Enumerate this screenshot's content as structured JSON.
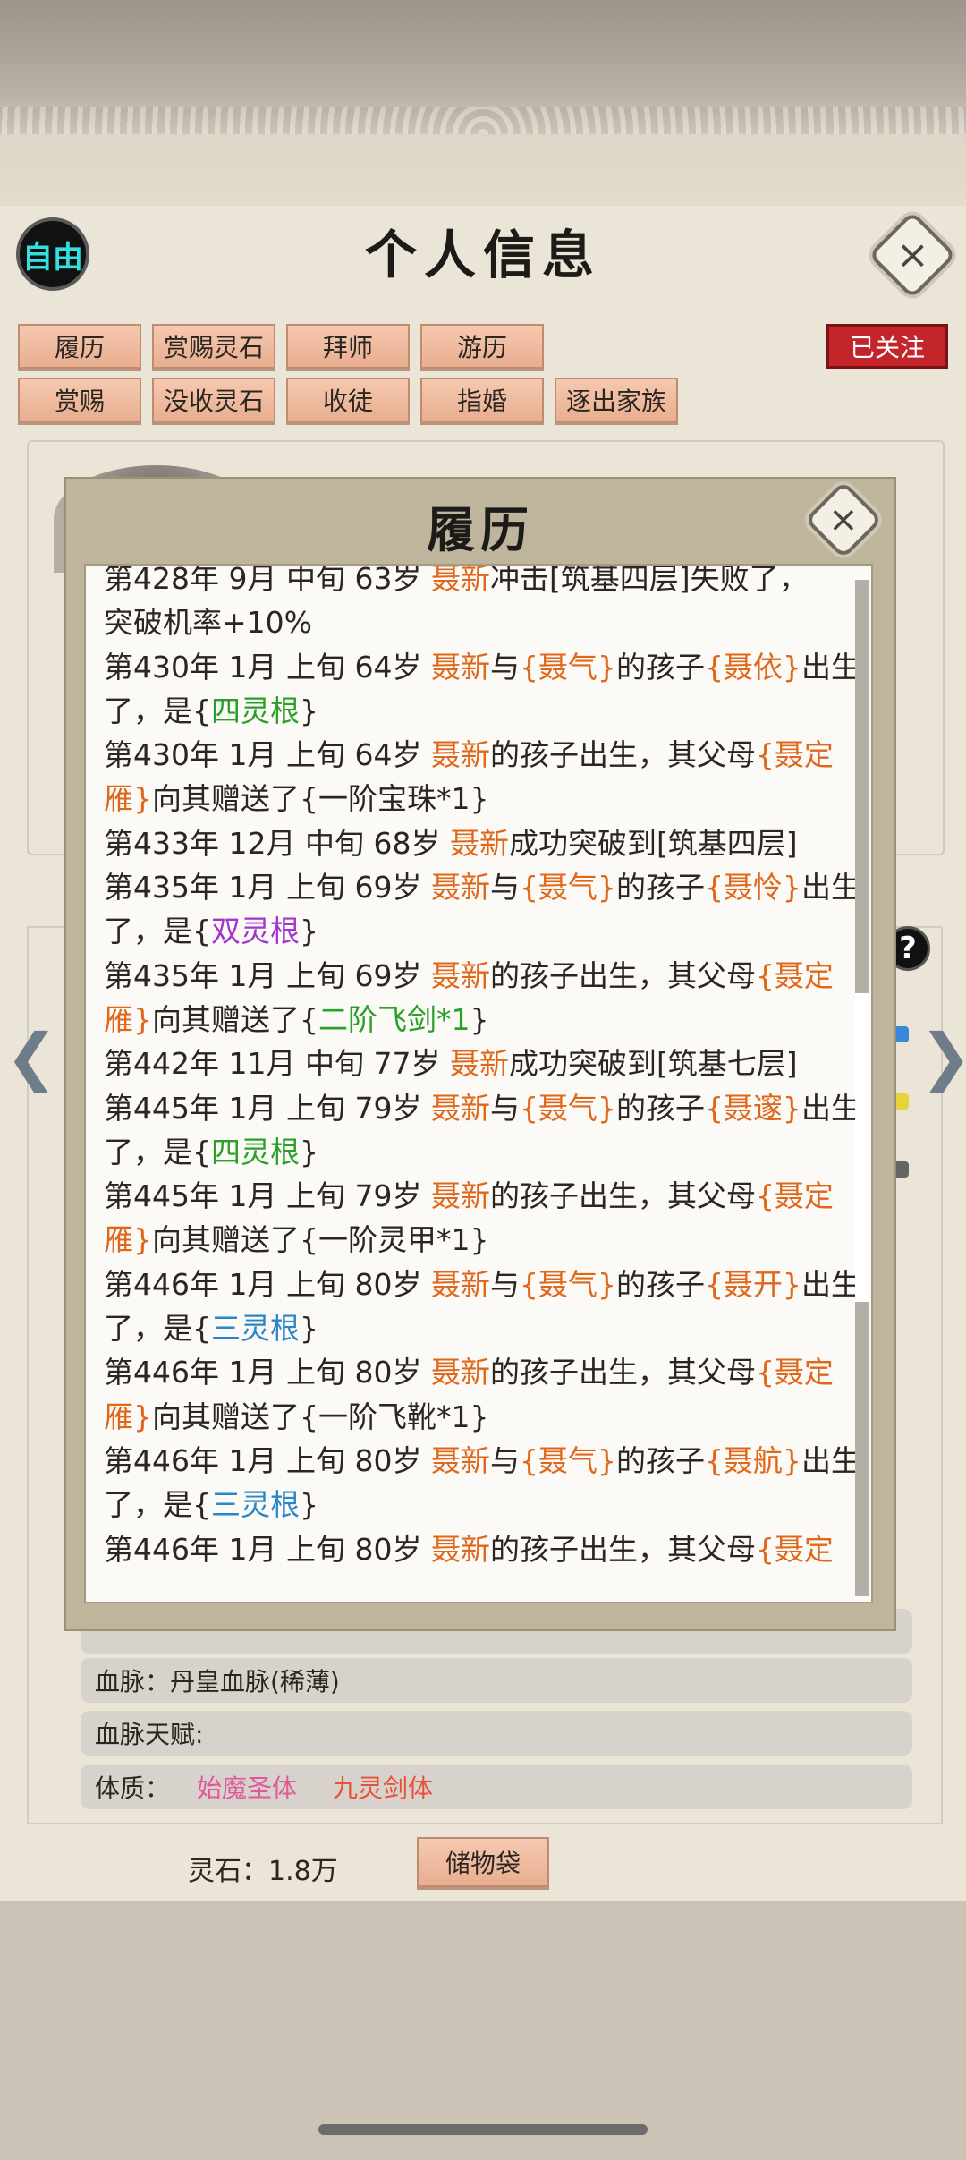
{
  "header": {
    "free_badge": "自由",
    "title": "个人信息",
    "close_icon": "×",
    "followed": "已关注"
  },
  "tabs_row1": [
    "履历",
    "赏赐灵石",
    "拜师",
    "游历"
  ],
  "tabs_row2": [
    "赏赐",
    "没收灵石",
    "收徒",
    "指婚",
    "逐出家族"
  ],
  "profile": {
    "bloodline": "血脉：丹皇血脉(稀薄)",
    "bloodline_talent": "血脉天赋:",
    "physique_label": "体质：",
    "physique_1": "始魔圣体",
    "physique_2": "九灵剑体",
    "physique_colors": [
      "#e0589a",
      "#e8503a"
    ],
    "spirit_stones": "灵石：1.8万",
    "storage_bag": "储物袋"
  },
  "modal": {
    "title": "履历",
    "close_icon": "×",
    "log_lines": [
      [
        {
          "t": "第428年 9月 中旬  63岁  "
        },
        {
          "t": "聂新",
          "c": "o"
        },
        {
          "t": "冲击[筑基四层]失败了，"
        }
      ],
      [
        {
          "t": "突破机率+10%"
        }
      ],
      [
        {
          "t": "第430年 1月 上旬 64岁 "
        },
        {
          "t": "聂新",
          "c": "o"
        },
        {
          "t": "与"
        },
        {
          "t": "{聂气}",
          "c": "o"
        },
        {
          "t": "的孩子"
        },
        {
          "t": "{聂依}",
          "c": "o"
        },
        {
          "t": "出生"
        }
      ],
      [
        {
          "t": "了，是{"
        },
        {
          "t": "四灵根",
          "c": "g"
        },
        {
          "t": "}"
        }
      ],
      [
        {
          "t": "第430年 1月 上旬 64岁 "
        },
        {
          "t": "聂新",
          "c": "o"
        },
        {
          "t": "的孩子出生，其父母"
        },
        {
          "t": "{聂定",
          "c": "o"
        }
      ],
      [
        {
          "t": "雁}",
          "c": "o"
        },
        {
          "t": "向其赠送了{一阶宝珠*1}"
        }
      ],
      [
        {
          "t": "第433年 12月 中旬  68岁  "
        },
        {
          "t": "聂新",
          "c": "o"
        },
        {
          "t": "成功突破到[筑基四层]"
        }
      ],
      [
        {
          "t": "第435年 1月 上旬 69岁 "
        },
        {
          "t": "聂新",
          "c": "o"
        },
        {
          "t": "与"
        },
        {
          "t": "{聂气}",
          "c": "o"
        },
        {
          "t": "的孩子"
        },
        {
          "t": "{聂怜}",
          "c": "o"
        },
        {
          "t": "出生"
        }
      ],
      [
        {
          "t": "了，是{"
        },
        {
          "t": "双灵根",
          "c": "p"
        },
        {
          "t": "}"
        }
      ],
      [
        {
          "t": "第435年 1月 上旬 69岁 "
        },
        {
          "t": "聂新",
          "c": "o"
        },
        {
          "t": "的孩子出生，其父母"
        },
        {
          "t": "{聂定",
          "c": "o"
        }
      ],
      [
        {
          "t": "雁}",
          "c": "o"
        },
        {
          "t": "向其赠送了{"
        },
        {
          "t": "二阶飞剑*1",
          "c": "g"
        },
        {
          "t": "}"
        }
      ],
      [
        {
          "t": "第442年 11月 中旬  77岁  "
        },
        {
          "t": "聂新",
          "c": "o"
        },
        {
          "t": "成功突破到[筑基七层]"
        }
      ],
      [
        {
          "t": "第445年 1月 上旬 79岁 "
        },
        {
          "t": "聂新",
          "c": "o"
        },
        {
          "t": "与"
        },
        {
          "t": "{聂气}",
          "c": "o"
        },
        {
          "t": "的孩子"
        },
        {
          "t": "{聂邃}",
          "c": "o"
        },
        {
          "t": "出生"
        }
      ],
      [
        {
          "t": "了，是{"
        },
        {
          "t": "四灵根",
          "c": "g"
        },
        {
          "t": "}"
        }
      ],
      [
        {
          "t": "第445年 1月 上旬 79岁 "
        },
        {
          "t": "聂新",
          "c": "o"
        },
        {
          "t": "的孩子出生，其父母"
        },
        {
          "t": "{聂定",
          "c": "o"
        }
      ],
      [
        {
          "t": "雁}",
          "c": "o"
        },
        {
          "t": "向其赠送了{一阶灵甲*1}"
        }
      ],
      [
        {
          "t": "第446年 1月 上旬 80岁 "
        },
        {
          "t": "聂新",
          "c": "o"
        },
        {
          "t": "与"
        },
        {
          "t": "{聂气}",
          "c": "o"
        },
        {
          "t": "的孩子"
        },
        {
          "t": "{聂开}",
          "c": "o"
        },
        {
          "t": "出生"
        }
      ],
      [
        {
          "t": "了，是{"
        },
        {
          "t": "三灵根",
          "c": "b"
        },
        {
          "t": "}"
        }
      ],
      [
        {
          "t": "第446年 1月 上旬 80岁 "
        },
        {
          "t": "聂新",
          "c": "o"
        },
        {
          "t": "的孩子出生，其父母"
        },
        {
          "t": "{聂定",
          "c": "o"
        }
      ],
      [
        {
          "t": "雁}",
          "c": "o"
        },
        {
          "t": "向其赠送了{一阶飞靴*1}"
        }
      ],
      [
        {
          "t": "第446年 1月 上旬 80岁 "
        },
        {
          "t": "聂新",
          "c": "o"
        },
        {
          "t": "与"
        },
        {
          "t": "{聂气}",
          "c": "o"
        },
        {
          "t": "的孩子"
        },
        {
          "t": "{聂航}",
          "c": "o"
        },
        {
          "t": "出生"
        }
      ],
      [
        {
          "t": "了，是{"
        },
        {
          "t": "三灵根",
          "c": "b"
        },
        {
          "t": "}"
        }
      ],
      [
        {
          "t": "第446年 1月 上旬 80岁 "
        },
        {
          "t": "聂新",
          "c": "o"
        },
        {
          "t": "的孩子出生，其父母"
        },
        {
          "t": "{聂定",
          "c": "o"
        }
      ]
    ],
    "scroll_position": 0.4
  },
  "icons": {
    "help": "?",
    "nav_left": "❮",
    "nav_right": "❯"
  },
  "colors": {
    "orange": "#e0671a",
    "green": "#2aa02a",
    "purple": "#a035d0",
    "blue": "#2a86c8",
    "follow_red": "#c4252b",
    "tab": "#f0bda2"
  }
}
